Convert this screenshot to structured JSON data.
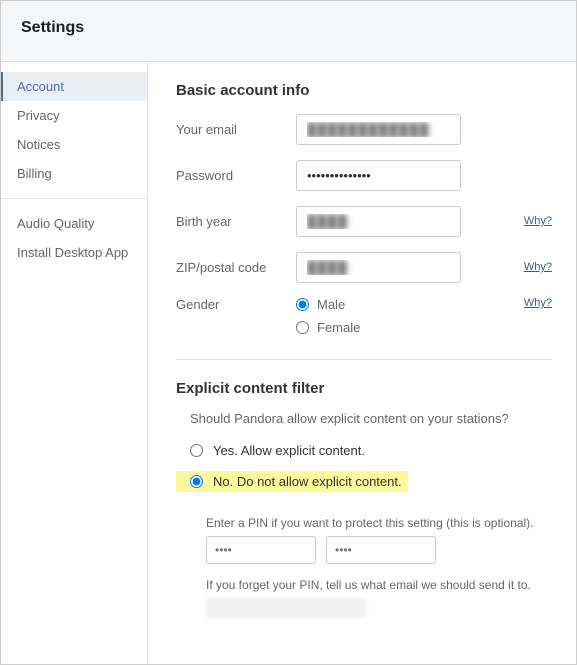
{
  "header": {
    "title": "Settings"
  },
  "sidebar": {
    "group1": [
      {
        "label": "Account",
        "active": true
      },
      {
        "label": "Privacy"
      },
      {
        "label": "Notices"
      },
      {
        "label": "Billing"
      }
    ],
    "group2": [
      {
        "label": "Audio Quality"
      },
      {
        "label": "Install Desktop App"
      }
    ]
  },
  "basic": {
    "title": "Basic account info",
    "email_label": "Your email",
    "email_value": "████████████",
    "password_label": "Password",
    "password_value": "••••••••••••••",
    "birth_label": "Birth year",
    "birth_value": "████",
    "zip_label": "ZIP/postal code",
    "zip_value": "████",
    "gender_label": "Gender",
    "gender_male": "Male",
    "gender_female": "Female",
    "gender_selected": "male",
    "why": "Why?"
  },
  "filter": {
    "title": "Explicit content filter",
    "question": "Should Pandora allow explicit content on your stations?",
    "yes_label": "Yes. Allow explicit content.",
    "no_label": "No. Do not allow explicit content.",
    "selected": "no",
    "pin_prompt": "Enter a PIN if you want to protect this setting (this is optional).",
    "pin_placeholder": "••••",
    "forgot_prompt": "If you forget your PIN, tell us what email we should send it to."
  }
}
